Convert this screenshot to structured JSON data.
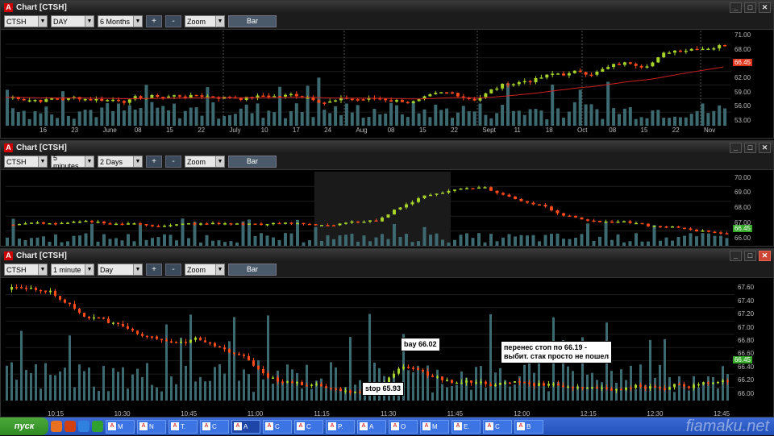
{
  "windows": [
    {
      "title": "Chart [CTSH]",
      "symbol": "CTSH",
      "interval": "DAY",
      "range": "6 Months",
      "zoom": "Zoom",
      "type_btn": "Bar",
      "plus": "+",
      "minus": "-",
      "yticks": [
        "71.00",
        "68.00",
        "65.00",
        "62.00",
        "59.00",
        "56.00",
        "53.00"
      ],
      "ymin": 52,
      "ymax": 72,
      "xticks": [
        "16",
        "23",
        "June",
        "08",
        "15",
        "22",
        "July",
        "10",
        "17",
        "24",
        "Aug",
        "08",
        "15",
        "22",
        "Sept",
        "11",
        "18",
        "Oct",
        "08",
        "15",
        "22",
        "Nov"
      ],
      "last_price": "66.45",
      "ma_label": ""
    },
    {
      "title": "Chart [CTSH]",
      "symbol": "CTSH",
      "interval": "5 minutes",
      "range": "2 Days",
      "zoom": "Zoom",
      "type_btn": "Bar",
      "plus": "+",
      "minus": "-",
      "yticks": [
        "70.00",
        "69.00",
        "68.00",
        "67.00",
        "66.00"
      ],
      "ymin": 65.5,
      "ymax": 70.4,
      "last_price": "66.45"
    },
    {
      "title": "Chart [CTSH]",
      "symbol": "CTSH",
      "interval": "1 minute",
      "range": "Day",
      "zoom": "Zoom",
      "type_btn": "Bar",
      "plus": "+",
      "minus": "-",
      "yticks": [
        "67.60",
        "67.40",
        "67.20",
        "67.00",
        "66.80",
        "66.60",
        "66.40",
        "66.20",
        "66.00"
      ],
      "ymin": 65.9,
      "ymax": 67.7,
      "xticks": [
        "10:15",
        "10:30",
        "10:45",
        "11:00",
        "11:15",
        "11:30",
        "11:45",
        "12:00",
        "12:15",
        "12:30",
        "12:45"
      ],
      "last_price": "66.45",
      "notes": {
        "buy": "bay 66.02",
        "stop": "stop 65.93",
        "moved_stop": "перенес стоп по 66.19 -\nвыбит. стак просто не пошел"
      }
    }
  ],
  "taskbar": {
    "start": "пуск",
    "items": [
      "M",
      "N",
      "T.",
      "C",
      "A",
      "C",
      "C",
      "P.",
      "A",
      "O",
      "M",
      "E.",
      "C",
      "B"
    ],
    "watermark": "fiamaku.net"
  },
  "colors": {
    "up": "#a6d22a",
    "down": "#ff4a1a",
    "volume": "#3d6a70",
    "ma": "#d02020",
    "badge_up": "#35a82a",
    "badge_down": "#e0341a"
  },
  "icons": {
    "window": "app-icon",
    "minimize": "minimize-icon",
    "maximize": "maximize-icon",
    "close": "close-icon"
  }
}
